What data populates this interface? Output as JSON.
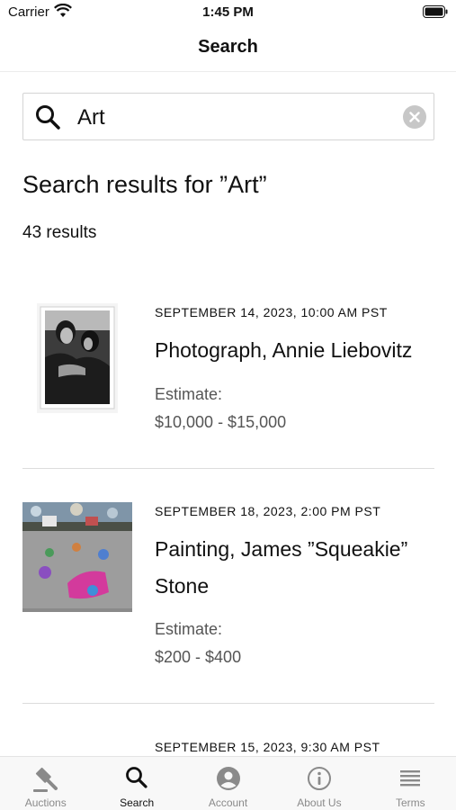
{
  "status": {
    "carrier": "Carrier",
    "time": "1:45 PM"
  },
  "nav": {
    "title": "Search"
  },
  "search": {
    "query": "Art"
  },
  "results": {
    "heading": "Search results for ”Art”",
    "count": "43 results",
    "items": [
      {
        "date": "SEPTEMBER 14, 2023, 10:00 AM PST",
        "title": "Photograph, Annie Liebovitz",
        "estimate_label": "Estimate:",
        "estimate": "$10,000 - $15,000"
      },
      {
        "date": "SEPTEMBER 18, 2023, 2:00 PM PST",
        "title": "Painting, James ”Squeakie” Stone",
        "estimate_label": "Estimate:",
        "estimate": "$200 - $400"
      },
      {
        "date": "SEPTEMBER 15, 2023, 9:30 AM PST"
      }
    ]
  },
  "tabs": [
    {
      "label": "Auctions",
      "icon": "gavel-icon",
      "active": false
    },
    {
      "label": "Search",
      "icon": "search-icon",
      "active": true
    },
    {
      "label": "Account",
      "icon": "account-icon",
      "active": false
    },
    {
      "label": "About Us",
      "icon": "info-icon",
      "active": false
    },
    {
      "label": "Terms",
      "icon": "list-icon",
      "active": false
    }
  ],
  "colors": {
    "active_tab": "#111111",
    "inactive_tab": "#8a8a8a",
    "estimate_text": "#555555"
  }
}
